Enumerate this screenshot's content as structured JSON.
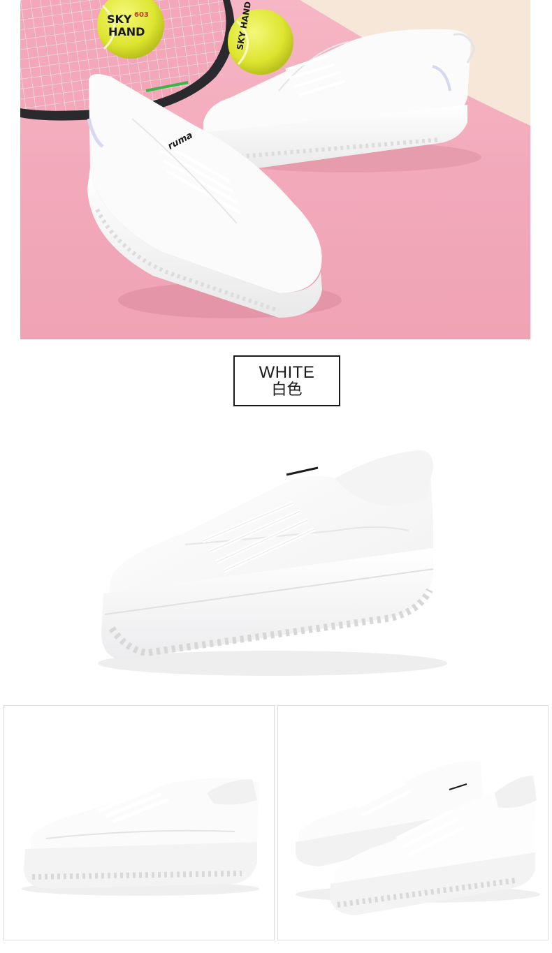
{
  "hero": {
    "ball_left_text_line1": "SKY",
    "ball_left_number": "603",
    "ball_left_text_line2": "HAND",
    "ball_right_text": "SKY HAND",
    "shoe_logo": "ruma"
  },
  "color_option": {
    "name_en": "WHITE",
    "name_zh": "白色"
  },
  "colors": {
    "background_pink": "#f2a9ba",
    "tennis_ball": "#e6ee3a",
    "shoe_white": "#fafafa",
    "label_border": "#1a1a1a"
  }
}
